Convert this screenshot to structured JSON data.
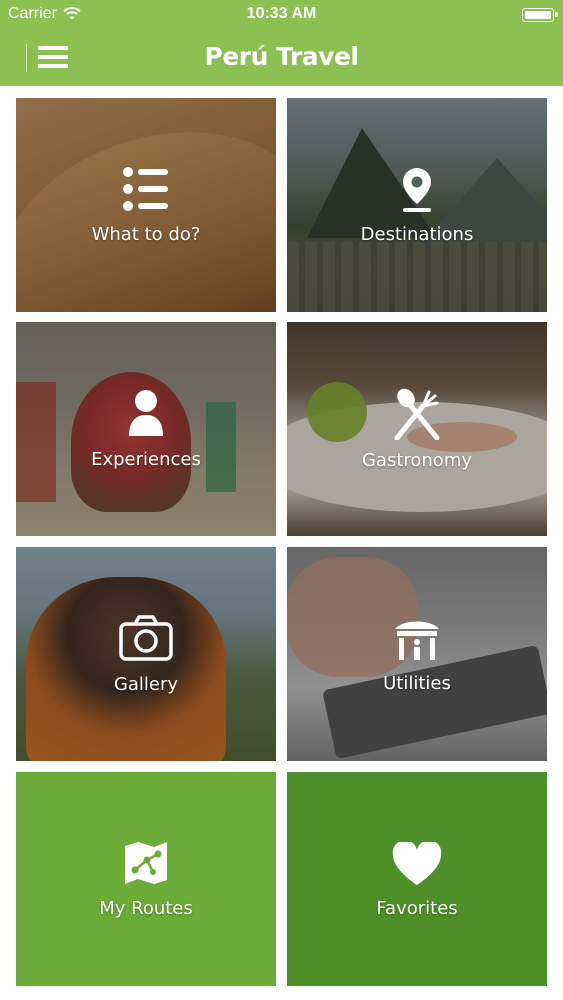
{
  "status_bar": {
    "carrier": "Carrier",
    "time": "10:33 AM",
    "icons": [
      "wifi-icon",
      "battery-icon"
    ]
  },
  "nav": {
    "title": "Perú Travel",
    "menu_icon": "hamburger-menu-icon"
  },
  "colors": {
    "nav_bg": "#8cc152",
    "tile_green_light": "#6bab37",
    "tile_green_dark": "#4f8f27",
    "text": "#ffffff"
  },
  "tiles": [
    {
      "label": "What to do?",
      "icon": "list-icon"
    },
    {
      "label": "Destinations",
      "icon": "map-pin-icon"
    },
    {
      "label": "Experiences",
      "icon": "person-icon"
    },
    {
      "label": "Gastronomy",
      "icon": "fork-spoon-icon"
    },
    {
      "label": "Gallery",
      "icon": "camera-icon"
    },
    {
      "label": "Utilities",
      "icon": "kiosk-info-icon"
    },
    {
      "label": "My Routes",
      "icon": "map-route-icon"
    },
    {
      "label": "Favorites",
      "icon": "heart-icon"
    }
  ]
}
